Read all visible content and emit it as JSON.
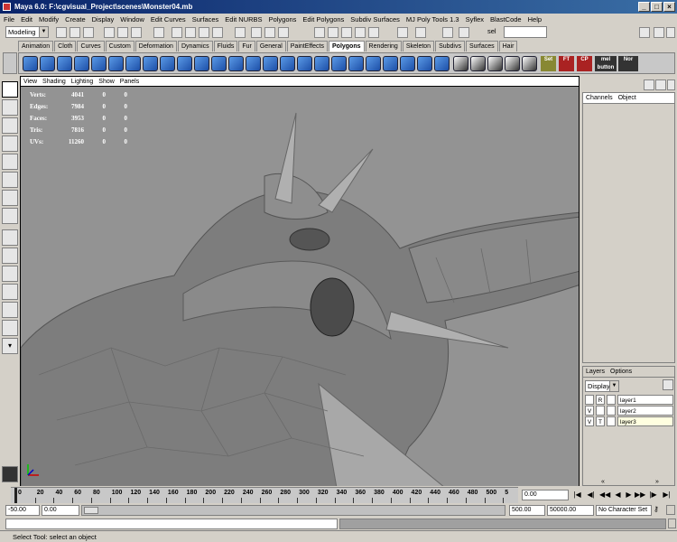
{
  "window": {
    "title": "Maya 6.0: F:\\cgvisual_Project\\scenes\\Monster04.mb"
  },
  "menu": [
    "File",
    "Edit",
    "Modify",
    "Create",
    "Display",
    "Window",
    "Edit Curves",
    "Surfaces",
    "Edit NURBS",
    "Polygons",
    "Edit Polygons",
    "Subdiv Surfaces",
    "MJ Poly Tools 1.3",
    "Syflex",
    "BlastCode",
    "Help"
  ],
  "toolbar": {
    "mode_select": "Modeling",
    "sel_field": "sel"
  },
  "shelf_tabs": [
    "Animation",
    "Cloth",
    "Curves",
    "Custom",
    "Deformation",
    "Dynamics",
    "Fluids",
    "Fur",
    "General",
    "PaintEffects",
    "Polygons",
    "Rendering",
    "Skeleton",
    "Subdivs",
    "Surfaces",
    "Hair"
  ],
  "shelf_active": "Polygons",
  "shelf_text_buttons": [
    "Set",
    "FT",
    "CP",
    "mel button",
    "Nor"
  ],
  "viewport": {
    "panel_menu": [
      "View",
      "Shading",
      "Lighting",
      "Show",
      "Panels"
    ],
    "hud": [
      {
        "label": "Verts:",
        "v1": "4041",
        "v2": "0",
        "v3": "0"
      },
      {
        "label": "Edges:",
        "v1": "7984",
        "v2": "0",
        "v3": "0"
      },
      {
        "label": "Faces:",
        "v1": "3953",
        "v2": "0",
        "v3": "0"
      },
      {
        "label": "Tris:",
        "v1": "7816",
        "v2": "0",
        "v3": "0"
      },
      {
        "label": "UVs:",
        "v1": "11260",
        "v2": "0",
        "v3": "0"
      }
    ]
  },
  "channel_box": {
    "tabs": [
      "Channels",
      "Object"
    ]
  },
  "layers": {
    "tabs": [
      "Layers",
      "Options"
    ],
    "display_select": "Display",
    "rows": [
      {
        "v": "",
        "t": "R",
        "name": "layer1"
      },
      {
        "v": "V",
        "t": "",
        "name": "layer2"
      },
      {
        "v": "V",
        "t": "T",
        "name": "layer3"
      }
    ]
  },
  "timeline": {
    "ticks": [
      "0",
      "20",
      "40",
      "60",
      "80",
      "100",
      "120",
      "140",
      "160",
      "180",
      "200",
      "220",
      "240",
      "260",
      "280",
      "300",
      "320",
      "340",
      "360",
      "380",
      "400",
      "420",
      "440",
      "460",
      "480",
      "500",
      "5"
    ],
    "current_frame": "0.00"
  },
  "range": {
    "start": "-50.00",
    "start2": "0.00",
    "end": "500.00",
    "end2": "50000.00",
    "character_set": "No Character Set"
  },
  "help_line": "Select Tool: select an object"
}
